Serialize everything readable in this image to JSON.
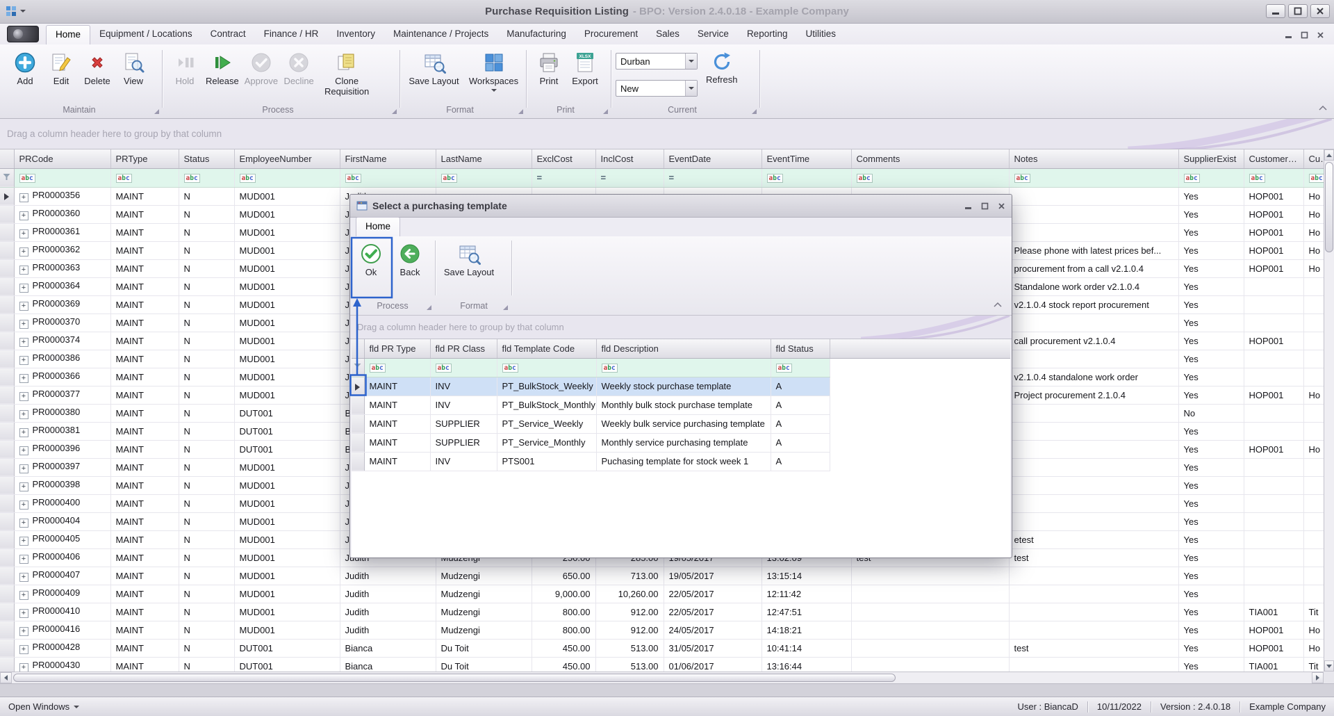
{
  "titlebar": {
    "title": "Purchase Requisition Listing",
    "subtitle": "- BPO: Version 2.4.0.18 - Example Company"
  },
  "active_tab": "Home",
  "tabs": [
    "Home",
    "Equipment / Locations",
    "Contract",
    "Finance / HR",
    "Inventory",
    "Maintenance / Projects",
    "Manufacturing",
    "Procurement",
    "Sales",
    "Service",
    "Reporting",
    "Utilities"
  ],
  "ribbon": {
    "maintain": {
      "caption": "Maintain",
      "add": "Add",
      "edit": "Edit",
      "delete": "Delete",
      "view": "View"
    },
    "process": {
      "caption": "Process",
      "hold": "Hold",
      "release": "Release",
      "approve": "Approve",
      "decline": "Decline",
      "clone": "Clone Requisition"
    },
    "format": {
      "caption": "Format",
      "save_layout": "Save Layout",
      "workspaces": "Workspaces"
    },
    "print": {
      "caption": "Print",
      "print": "Print",
      "export": "Export"
    },
    "current": {
      "caption": "Current",
      "combo1": "Durban",
      "combo2": "New",
      "refresh": "Refresh"
    }
  },
  "group_panel_text": "Drag a column header here to group by that column",
  "main_grid": {
    "columns": [
      "PRCode",
      "PRType",
      "Status",
      "EmployeeNumber",
      "FirstName",
      "LastName",
      "ExclCost",
      "InclCost",
      "EventDate",
      "EventTime",
      "Comments",
      "Notes",
      "SupplierExist",
      "CustomerCode",
      "CustomerName"
    ],
    "filter_icons": [
      "abc",
      "abc",
      "abc",
      "abc",
      "abc",
      "abc",
      "eq",
      "eq",
      "eq",
      "abc",
      "abc",
      "abc",
      "abc",
      "abc",
      "abc"
    ],
    "rows": [
      [
        "PR0000356",
        "MAINT",
        "N",
        "MUD001",
        "Judith",
        "",
        "",
        "",
        "",
        "",
        "",
        "",
        "Yes",
        "HOP001",
        "Ho"
      ],
      [
        "PR0000360",
        "MAINT",
        "N",
        "MUD001",
        "Judith",
        "",
        "",
        "",
        "",
        "",
        "",
        "",
        "Yes",
        "HOP001",
        "Ho"
      ],
      [
        "PR0000361",
        "MAINT",
        "N",
        "MUD001",
        "Judith",
        "",
        "",
        "",
        "",
        "",
        "",
        "",
        "Yes",
        "HOP001",
        "Ho"
      ],
      [
        "PR0000362",
        "MAINT",
        "N",
        "MUD001",
        "Judith",
        "",
        "",
        "",
        "",
        "",
        "",
        "Please phone with latest prices bef...",
        "Yes",
        "HOP001",
        "Ho"
      ],
      [
        "PR0000363",
        "MAINT",
        "N",
        "MUD001",
        "Judith",
        "",
        "",
        "",
        "",
        "",
        "",
        "procurement from a call v2.1.0.4",
        "Yes",
        "HOP001",
        "Ho"
      ],
      [
        "PR0000364",
        "MAINT",
        "N",
        "MUD001",
        "Judith",
        "",
        "",
        "",
        "",
        "",
        "",
        "Standalone work order v2.1.0.4",
        "Yes",
        "",
        ""
      ],
      [
        "PR0000369",
        "MAINT",
        "N",
        "MUD001",
        "Judith",
        "",
        "",
        "",
        "",
        "",
        "",
        "v2.1.0.4 stock report procurement",
        "Yes",
        "",
        ""
      ],
      [
        "PR0000370",
        "MAINT",
        "N",
        "MUD001",
        "Judith",
        "",
        "",
        "",
        "",
        "",
        "",
        "",
        "Yes",
        "",
        ""
      ],
      [
        "PR0000374",
        "MAINT",
        "N",
        "MUD001",
        "Judith",
        "",
        "",
        "",
        "",
        "",
        "",
        "call procurement v2.1.0.4",
        "Yes",
        "HOP001",
        ""
      ],
      [
        "PR0000386",
        "MAINT",
        "N",
        "MUD001",
        "Judith",
        "",
        "",
        "",
        "",
        "",
        "",
        "",
        "Yes",
        "",
        ""
      ],
      [
        "PR0000366",
        "MAINT",
        "N",
        "MUD001",
        "Judith",
        "",
        "",
        "",
        "",
        "",
        "",
        "v2.1.0.4 standalone work order",
        "Yes",
        "",
        ""
      ],
      [
        "PR0000377",
        "MAINT",
        "N",
        "MUD001",
        "Judith",
        "",
        "",
        "",
        "",
        "",
        "",
        "Project procurement 2.1.0.4",
        "Yes",
        "HOP001",
        "Ho"
      ],
      [
        "PR0000380",
        "MAINT",
        "N",
        "DUT001",
        "Bianca",
        "",
        "",
        "",
        "",
        "",
        "",
        "",
        "No",
        "",
        ""
      ],
      [
        "PR0000381",
        "MAINT",
        "N",
        "DUT001",
        "Bianca",
        "",
        "",
        "",
        "",
        "",
        "",
        "",
        "Yes",
        "",
        ""
      ],
      [
        "PR0000396",
        "MAINT",
        "N",
        "DUT001",
        "Bianca",
        "",
        "",
        "",
        "",
        "",
        "",
        "",
        "Yes",
        "HOP001",
        "Ho"
      ],
      [
        "PR0000397",
        "MAINT",
        "N",
        "MUD001",
        "Judith",
        "",
        "",
        "",
        "",
        "",
        "",
        "",
        "Yes",
        "",
        ""
      ],
      [
        "PR0000398",
        "MAINT",
        "N",
        "MUD001",
        "Judith",
        "",
        "",
        "",
        "",
        "",
        "",
        "",
        "Yes",
        "",
        ""
      ],
      [
        "PR0000400",
        "MAINT",
        "N",
        "MUD001",
        "Judith",
        "",
        "",
        "",
        "",
        "",
        "",
        "",
        "Yes",
        "",
        ""
      ],
      [
        "PR0000404",
        "MAINT",
        "N",
        "MUD001",
        "Judith",
        "",
        "",
        "",
        "",
        "",
        "",
        "",
        "Yes",
        "",
        ""
      ],
      [
        "PR0000405",
        "MAINT",
        "N",
        "MUD001",
        "Judith",
        "",
        "",
        "",
        "",
        "",
        "",
        "etest",
        "Yes",
        "",
        ""
      ],
      [
        "PR0000406",
        "MAINT",
        "N",
        "MUD001",
        "Judith",
        "Mudzengi",
        "250.00",
        "285.00",
        "19/05/2017",
        "13:02:09",
        "test",
        "test",
        "Yes",
        "",
        ""
      ],
      [
        "PR0000407",
        "MAINT",
        "N",
        "MUD001",
        "Judith",
        "Mudzengi",
        "650.00",
        "713.00",
        "19/05/2017",
        "13:15:14",
        "",
        "",
        "Yes",
        "",
        ""
      ],
      [
        "PR0000409",
        "MAINT",
        "N",
        "MUD001",
        "Judith",
        "Mudzengi",
        "9,000.00",
        "10,260.00",
        "22/05/2017",
        "12:11:42",
        "",
        "",
        "Yes",
        "",
        ""
      ],
      [
        "PR0000410",
        "MAINT",
        "N",
        "MUD001",
        "Judith",
        "Mudzengi",
        "800.00",
        "912.00",
        "22/05/2017",
        "12:47:51",
        "",
        "",
        "Yes",
        "TIA001",
        "Tit"
      ],
      [
        "PR0000416",
        "MAINT",
        "N",
        "MUD001",
        "Judith",
        "Mudzengi",
        "800.00",
        "912.00",
        "24/05/2017",
        "14:18:21",
        "",
        "",
        "Yes",
        "HOP001",
        "Ho"
      ],
      [
        "PR0000428",
        "MAINT",
        "N",
        "DUT001",
        "Bianca",
        "Du Toit",
        "450.00",
        "513.00",
        "31/05/2017",
        "10:41:14",
        "",
        "test",
        "Yes",
        "HOP001",
        "Ho"
      ],
      [
        "PR0000430",
        "MAINT",
        "N",
        "DUT001",
        "Bianca",
        "Du Toit",
        "450.00",
        "513.00",
        "01/06/2017",
        "13:16:44",
        "",
        "",
        "Yes",
        "TIA001",
        "Tit"
      ]
    ]
  },
  "dialog": {
    "title": "Select a purchasing template",
    "tab": "Home",
    "ok": "Ok",
    "back": "Back",
    "save_layout": "Save Layout",
    "process_caption": "Process",
    "format_caption": "Format",
    "group_panel_text": "Drag a column header here to group by that column",
    "grid": {
      "columns": [
        "fld PR Type",
        "fld PR Class",
        "fld Template Code",
        "fld Description",
        "fld Status"
      ],
      "filter_icons": [
        "abc",
        "abc",
        "abc",
        "abc",
        "abc"
      ],
      "rows": [
        [
          "MAINT",
          "INV",
          "PT_BulkStock_Weekly",
          "Weekly stock purchase template",
          "A"
        ],
        [
          "MAINT",
          "INV",
          "PT_BulkStock_Monthly",
          "Monthly bulk stock purchase template",
          "A"
        ],
        [
          "MAINT",
          "SUPPLIER",
          "PT_Service_Weekly",
          "Weekly bulk service purchasing template",
          "A"
        ],
        [
          "MAINT",
          "SUPPLIER",
          "PT_Service_Monthly",
          "Monthly service purchasing template",
          "A"
        ],
        [
          "MAINT",
          "INV",
          "PTS001",
          "Puchasing template for stock week 1",
          "A"
        ]
      ]
    }
  },
  "statusbar": {
    "open_windows": "Open Windows",
    "user": "User : BiancaD",
    "date": "10/11/2022",
    "version": "Version : 2.4.0.18",
    "company": "Example Company"
  }
}
